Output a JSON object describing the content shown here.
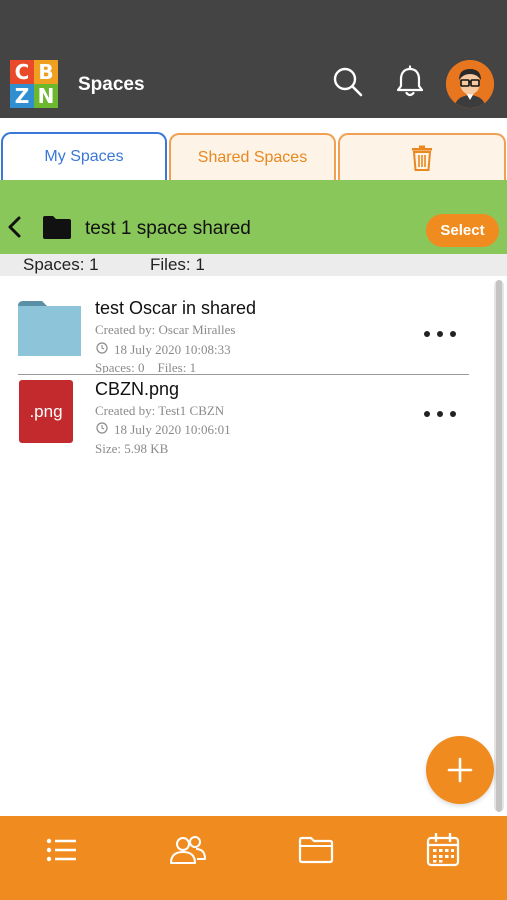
{
  "app": {
    "logo_letters": [
      "C",
      "B",
      "Z",
      "N"
    ],
    "logo_colors": [
      "#e84a2a",
      "#f0a020",
      "#2f8fd0",
      "#6cb82e"
    ],
    "title": "Spaces"
  },
  "tabs": [
    {
      "label": "My Spaces",
      "active": true
    },
    {
      "label": "Shared Spaces",
      "active": false
    },
    {
      "label": "",
      "icon": "trash-icon",
      "active": false
    }
  ],
  "breadcrumb": {
    "back_icon": "chevron-left-icon",
    "folder_icon": "folder-icon",
    "title": "test 1 space shared",
    "select_label": "Select"
  },
  "counts": {
    "spaces": "Spaces: 1",
    "files": "Files: 1"
  },
  "items": [
    {
      "type": "folder",
      "icon": "folder-icon",
      "title": "test Oscar in shared",
      "created_by": "Created by: Oscar Miralles",
      "date": "18 July 2020 10:08:33",
      "extra": "Spaces: 0    Files: 1"
    },
    {
      "type": "file",
      "icon": "png-file-icon",
      "icon_label": ".png",
      "title": "CBZN.png",
      "created_by": "Created by: Test1 CBZN",
      "date": "18 July 2020 10:06:01",
      "extra": "Size: 5.98 KB"
    }
  ],
  "colors": {
    "header": "#444444",
    "accent_orange": "#f08c1f",
    "green_bar": "#8ac75a",
    "active_tab_blue": "#3a78d8"
  },
  "bottom_nav": [
    {
      "icon": "list-icon"
    },
    {
      "icon": "users-icon"
    },
    {
      "icon": "folder-icon"
    },
    {
      "icon": "calendar-icon"
    }
  ]
}
